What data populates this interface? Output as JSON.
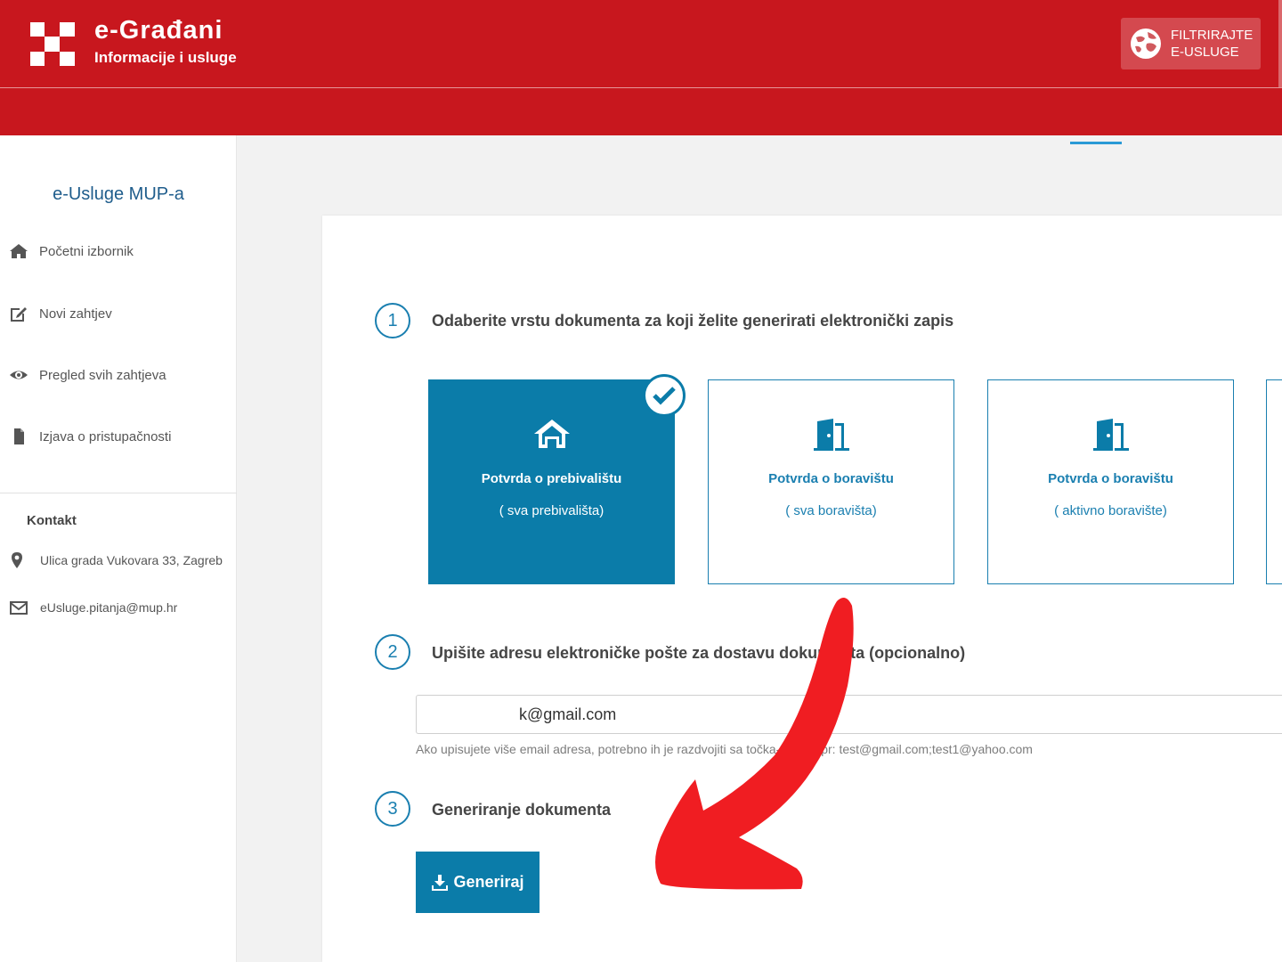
{
  "header": {
    "title": "e-Građani",
    "subtitle": "Informacije i usluge",
    "filter_button": "FILTRIRAJTE E-USLUGE",
    "background_color": "#c8171e"
  },
  "sidebar": {
    "title": "e-Usluge MUP-a",
    "items": [
      {
        "label": "Početni izbornik",
        "icon": "home-icon"
      },
      {
        "label": "Novi zahtjev",
        "icon": "edit-icon"
      },
      {
        "label": "Pregled svih zahtjeva",
        "icon": "eye-icon"
      },
      {
        "label": "Izjava o pristupačnosti",
        "icon": "file-icon"
      }
    ],
    "contact": {
      "title": "Kontakt",
      "address": "Ulica grada Vukovara 33, Zagreb",
      "email": "eUsluge.pitanja@mup.hr"
    }
  },
  "steps": [
    {
      "number": "1",
      "label": "Odaberite vrstu dokumenta za koji želite generirati elektronički zapis"
    },
    {
      "number": "2",
      "label": "Upišite adresu elektroničke pošte za dostavu dokumenta (opcionalno)"
    },
    {
      "number": "3",
      "label": "Generiranje dokumenta"
    }
  ],
  "documents": [
    {
      "name": "Potvrda o prebivalištu",
      "sub": "( sva prebivališta)",
      "selected": true,
      "icon": "house-icon"
    },
    {
      "name": "Potvrda o boravištu",
      "sub": "( sva boravišta)",
      "selected": false,
      "icon": "door-icon"
    },
    {
      "name": "Potvrda o boravištu",
      "sub": "( aktivno boravište)",
      "selected": false,
      "icon": "door-icon"
    }
  ],
  "email": {
    "value": "k@gmail.com",
    "hint": "Ako upisujete više email adresa, potrebno ih je razdvojiti sa točka-zarez npr: test@gmail.com;test1@yahoo.com"
  },
  "generate_button": "Generiraj",
  "colors": {
    "accent": "#0b7ca9",
    "arrow": "#f01d22"
  }
}
